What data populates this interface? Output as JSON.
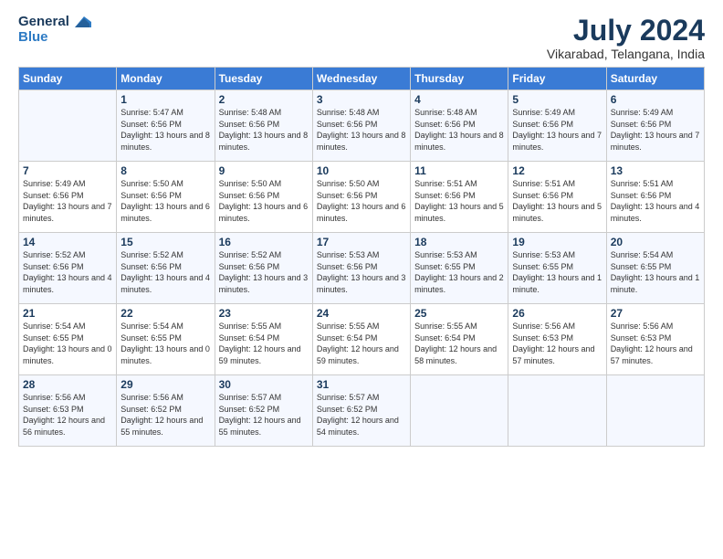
{
  "logo": {
    "line1": "General",
    "line2": "Blue"
  },
  "title": "July 2024",
  "subtitle": "Vikarabad, Telangana, India",
  "weekdays": [
    "Sunday",
    "Monday",
    "Tuesday",
    "Wednesday",
    "Thursday",
    "Friday",
    "Saturday"
  ],
  "weeks": [
    [
      {
        "day": "",
        "sunrise": "",
        "sunset": "",
        "daylight": ""
      },
      {
        "day": "1",
        "sunrise": "Sunrise: 5:47 AM",
        "sunset": "Sunset: 6:56 PM",
        "daylight": "Daylight: 13 hours and 8 minutes."
      },
      {
        "day": "2",
        "sunrise": "Sunrise: 5:48 AM",
        "sunset": "Sunset: 6:56 PM",
        "daylight": "Daylight: 13 hours and 8 minutes."
      },
      {
        "day": "3",
        "sunrise": "Sunrise: 5:48 AM",
        "sunset": "Sunset: 6:56 PM",
        "daylight": "Daylight: 13 hours and 8 minutes."
      },
      {
        "day": "4",
        "sunrise": "Sunrise: 5:48 AM",
        "sunset": "Sunset: 6:56 PM",
        "daylight": "Daylight: 13 hours and 8 minutes."
      },
      {
        "day": "5",
        "sunrise": "Sunrise: 5:49 AM",
        "sunset": "Sunset: 6:56 PM",
        "daylight": "Daylight: 13 hours and 7 minutes."
      },
      {
        "day": "6",
        "sunrise": "Sunrise: 5:49 AM",
        "sunset": "Sunset: 6:56 PM",
        "daylight": "Daylight: 13 hours and 7 minutes."
      }
    ],
    [
      {
        "day": "7",
        "sunrise": "Sunrise: 5:49 AM",
        "sunset": "Sunset: 6:56 PM",
        "daylight": "Daylight: 13 hours and 7 minutes."
      },
      {
        "day": "8",
        "sunrise": "Sunrise: 5:50 AM",
        "sunset": "Sunset: 6:56 PM",
        "daylight": "Daylight: 13 hours and 6 minutes."
      },
      {
        "day": "9",
        "sunrise": "Sunrise: 5:50 AM",
        "sunset": "Sunset: 6:56 PM",
        "daylight": "Daylight: 13 hours and 6 minutes."
      },
      {
        "day": "10",
        "sunrise": "Sunrise: 5:50 AM",
        "sunset": "Sunset: 6:56 PM",
        "daylight": "Daylight: 13 hours and 6 minutes."
      },
      {
        "day": "11",
        "sunrise": "Sunrise: 5:51 AM",
        "sunset": "Sunset: 6:56 PM",
        "daylight": "Daylight: 13 hours and 5 minutes."
      },
      {
        "day": "12",
        "sunrise": "Sunrise: 5:51 AM",
        "sunset": "Sunset: 6:56 PM",
        "daylight": "Daylight: 13 hours and 5 minutes."
      },
      {
        "day": "13",
        "sunrise": "Sunrise: 5:51 AM",
        "sunset": "Sunset: 6:56 PM",
        "daylight": "Daylight: 13 hours and 4 minutes."
      }
    ],
    [
      {
        "day": "14",
        "sunrise": "Sunrise: 5:52 AM",
        "sunset": "Sunset: 6:56 PM",
        "daylight": "Daylight: 13 hours and 4 minutes."
      },
      {
        "day": "15",
        "sunrise": "Sunrise: 5:52 AM",
        "sunset": "Sunset: 6:56 PM",
        "daylight": "Daylight: 13 hours and 4 minutes."
      },
      {
        "day": "16",
        "sunrise": "Sunrise: 5:52 AM",
        "sunset": "Sunset: 6:56 PM",
        "daylight": "Daylight: 13 hours and 3 minutes."
      },
      {
        "day": "17",
        "sunrise": "Sunrise: 5:53 AM",
        "sunset": "Sunset: 6:56 PM",
        "daylight": "Daylight: 13 hours and 3 minutes."
      },
      {
        "day": "18",
        "sunrise": "Sunrise: 5:53 AM",
        "sunset": "Sunset: 6:55 PM",
        "daylight": "Daylight: 13 hours and 2 minutes."
      },
      {
        "day": "19",
        "sunrise": "Sunrise: 5:53 AM",
        "sunset": "Sunset: 6:55 PM",
        "daylight": "Daylight: 13 hours and 1 minute."
      },
      {
        "day": "20",
        "sunrise": "Sunrise: 5:54 AM",
        "sunset": "Sunset: 6:55 PM",
        "daylight": "Daylight: 13 hours and 1 minute."
      }
    ],
    [
      {
        "day": "21",
        "sunrise": "Sunrise: 5:54 AM",
        "sunset": "Sunset: 6:55 PM",
        "daylight": "Daylight: 13 hours and 0 minutes."
      },
      {
        "day": "22",
        "sunrise": "Sunrise: 5:54 AM",
        "sunset": "Sunset: 6:55 PM",
        "daylight": "Daylight: 13 hours and 0 minutes."
      },
      {
        "day": "23",
        "sunrise": "Sunrise: 5:55 AM",
        "sunset": "Sunset: 6:54 PM",
        "daylight": "Daylight: 12 hours and 59 minutes."
      },
      {
        "day": "24",
        "sunrise": "Sunrise: 5:55 AM",
        "sunset": "Sunset: 6:54 PM",
        "daylight": "Daylight: 12 hours and 59 minutes."
      },
      {
        "day": "25",
        "sunrise": "Sunrise: 5:55 AM",
        "sunset": "Sunset: 6:54 PM",
        "daylight": "Daylight: 12 hours and 58 minutes."
      },
      {
        "day": "26",
        "sunrise": "Sunrise: 5:56 AM",
        "sunset": "Sunset: 6:53 PM",
        "daylight": "Daylight: 12 hours and 57 minutes."
      },
      {
        "day": "27",
        "sunrise": "Sunrise: 5:56 AM",
        "sunset": "Sunset: 6:53 PM",
        "daylight": "Daylight: 12 hours and 57 minutes."
      }
    ],
    [
      {
        "day": "28",
        "sunrise": "Sunrise: 5:56 AM",
        "sunset": "Sunset: 6:53 PM",
        "daylight": "Daylight: 12 hours and 56 minutes."
      },
      {
        "day": "29",
        "sunrise": "Sunrise: 5:56 AM",
        "sunset": "Sunset: 6:52 PM",
        "daylight": "Daylight: 12 hours and 55 minutes."
      },
      {
        "day": "30",
        "sunrise": "Sunrise: 5:57 AM",
        "sunset": "Sunset: 6:52 PM",
        "daylight": "Daylight: 12 hours and 55 minutes."
      },
      {
        "day": "31",
        "sunrise": "Sunrise: 5:57 AM",
        "sunset": "Sunset: 6:52 PM",
        "daylight": "Daylight: 12 hours and 54 minutes."
      },
      {
        "day": "",
        "sunrise": "",
        "sunset": "",
        "daylight": ""
      },
      {
        "day": "",
        "sunrise": "",
        "sunset": "",
        "daylight": ""
      },
      {
        "day": "",
        "sunrise": "",
        "sunset": "",
        "daylight": ""
      }
    ]
  ]
}
